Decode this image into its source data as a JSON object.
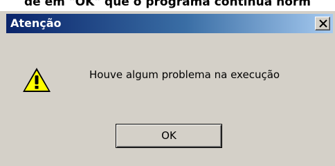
{
  "background_text": "de em \"OK\" que o programa continua norm",
  "dialog": {
    "title": "Atenção",
    "close_label": "×",
    "icon": "warning-icon",
    "message": "Houve algum problema na execução",
    "ok_label": "OK"
  },
  "colors": {
    "titlebar_start": "#0a246a",
    "titlebar_end": "#a6caf0",
    "dialog_face": "#d4d0c8",
    "warning_yellow": "#ffff00"
  }
}
